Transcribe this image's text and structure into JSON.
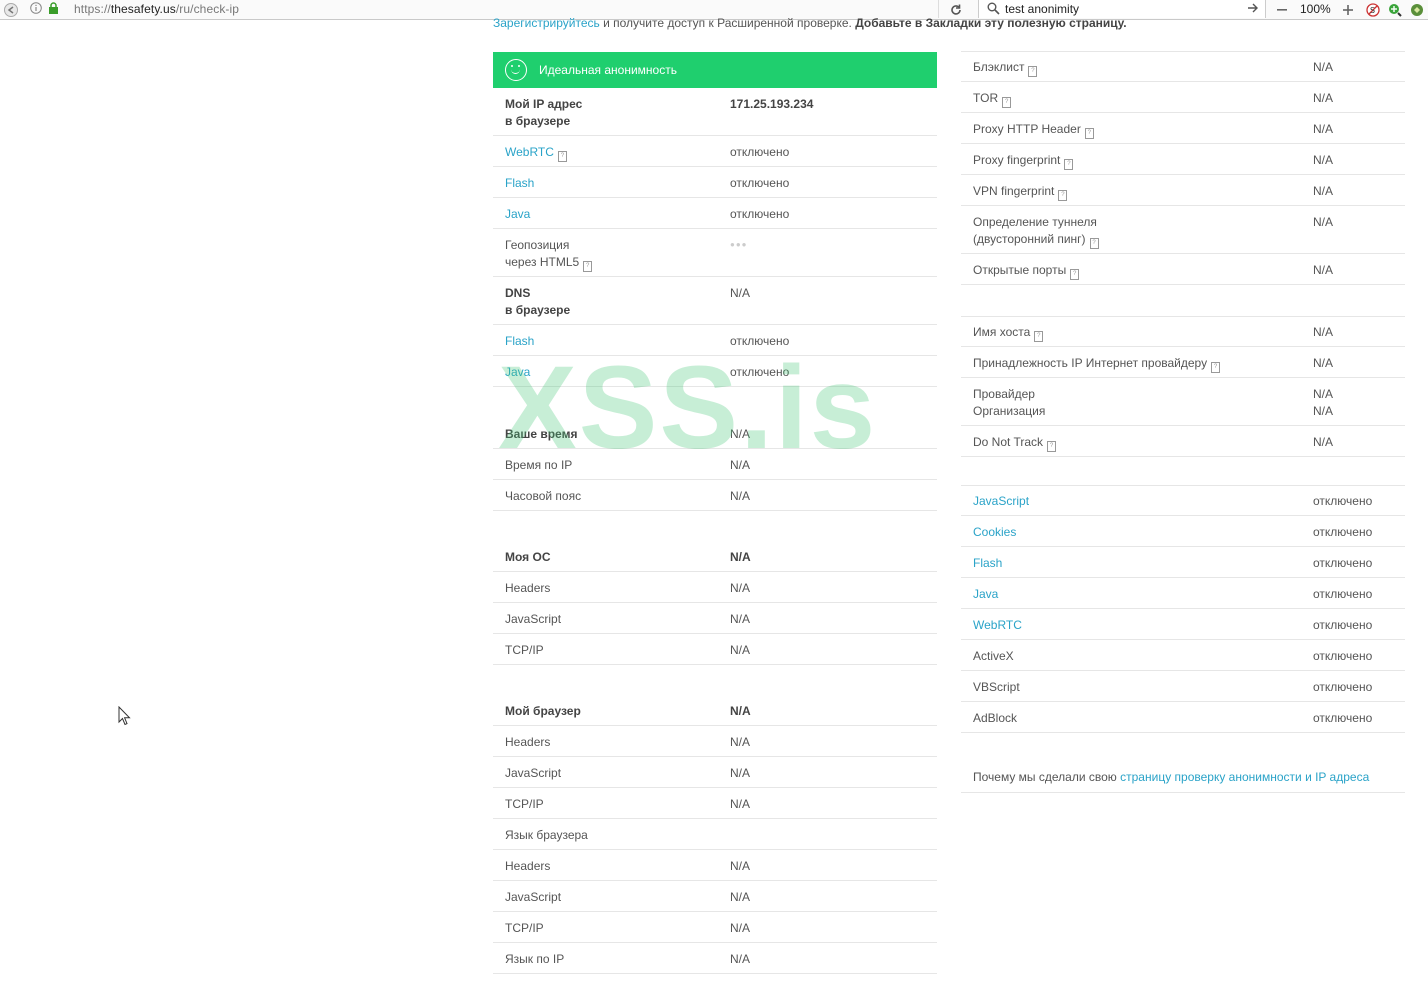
{
  "browser": {
    "url_prefix": "https://",
    "url_host": "thesafety.us",
    "url_path": "/ru/check-ip",
    "search_value": "test anonimity",
    "zoom": "100%"
  },
  "top_note": {
    "link": "Зарегистрируйтесь",
    "text": " и получите доступ к Расширенной проверке. ",
    "bold": "Добавьте в Закладки эту полезную страницу."
  },
  "banner": {
    "label": "Идеальная анонимность"
  },
  "left_table": [
    {
      "k": "Мой IP адрес",
      "k2": "в браузере",
      "v": "171.25.193.234",
      "kbold": true,
      "vbold": true
    },
    {
      "k": "WebRTC",
      "v": "отключено",
      "link": true,
      "info": true
    },
    {
      "k": "Flash",
      "v": "отключено",
      "link": true
    },
    {
      "k": "Java",
      "v": "отключено",
      "link": true
    },
    {
      "k": "Геопозиция",
      "k2": "через HTML5",
      "v": "",
      "info2": true
    },
    {
      "k": "DNS",
      "k2": "в браузере",
      "v": "N/A",
      "kbold": true
    },
    {
      "k": "Flash",
      "v": "отключено",
      "link": true
    },
    {
      "k": "Java",
      "v": "отключено",
      "link": true
    },
    {
      "k": "Ваше время",
      "v": "N/A",
      "kbold": true
    },
    {
      "k": "Время по IP",
      "v": "N/A"
    },
    {
      "k": "Часовой пояс",
      "v": "N/A"
    },
    {
      "k": "Моя ОС",
      "v": "N/A",
      "kbold": true,
      "vbold": true
    },
    {
      "k": "Headers",
      "v": "N/A"
    },
    {
      "k": "JavaScript",
      "v": "N/A"
    },
    {
      "k": "TCP/IP",
      "v": "N/A"
    },
    {
      "k": "Мой браузер",
      "v": "N/A",
      "kbold": true,
      "vbold": true
    },
    {
      "k": "Headers",
      "v": "N/A"
    },
    {
      "k": "JavaScript",
      "v": "N/A"
    },
    {
      "k": "TCP/IP",
      "v": "N/A"
    },
    {
      "k": "Язык браузера",
      "v": ""
    },
    {
      "k": "Headers",
      "v": "N/A"
    },
    {
      "k": "JavaScript",
      "v": "N/A"
    },
    {
      "k": "TCP/IP",
      "v": "N/A"
    },
    {
      "k": "Язык по IP",
      "v": "N/A"
    }
  ],
  "right_table": [
    {
      "k": "Блэклист",
      "v": "N/A",
      "info": true
    },
    {
      "k": "TOR",
      "v": "N/A",
      "info": true
    },
    {
      "k": "Proxy HTTP Header",
      "v": "N/A",
      "info": true
    },
    {
      "k": "Proxy fingerprint",
      "v": "N/A",
      "info": true
    },
    {
      "k": "VPN fingerprint",
      "v": "N/A",
      "info": true
    },
    {
      "k": "Определение туннеля",
      "k2": "(двусторонний пинг)",
      "v": "N/A",
      "info2": true
    },
    {
      "k": "Открытые порты",
      "v": "N/A",
      "info": true
    },
    {
      "k": "Имя хоста",
      "v": "N/A",
      "info": true
    },
    {
      "k": "Принадлежность IP Интернет провайдеру",
      "v": "N/A",
      "info": true
    },
    {
      "k": "Провайдер",
      "k2": "Организация",
      "v": "N/A",
      "v2": "N/A"
    },
    {
      "k": "Do Not Track",
      "v": "N/A",
      "info": true
    },
    {
      "k": "JavaScript",
      "v": "отключено",
      "link": true
    },
    {
      "k": "Cookies",
      "v": "отключено",
      "link": true
    },
    {
      "k": "Flash",
      "v": "отключено",
      "link": true
    },
    {
      "k": "Java",
      "v": "отключено",
      "link": true
    },
    {
      "k": "WebRTC",
      "v": "отключено",
      "link": true
    },
    {
      "k": "ActiveX",
      "v": "отключено"
    },
    {
      "k": "VBScript",
      "v": "отключено"
    },
    {
      "k": "AdBlock",
      "v": "отключено"
    }
  ],
  "footer_note": {
    "text": "Почему мы сделали свою ",
    "link": "страницу проверку анонимности и IP адреса"
  },
  "watermark": "XSS.is"
}
